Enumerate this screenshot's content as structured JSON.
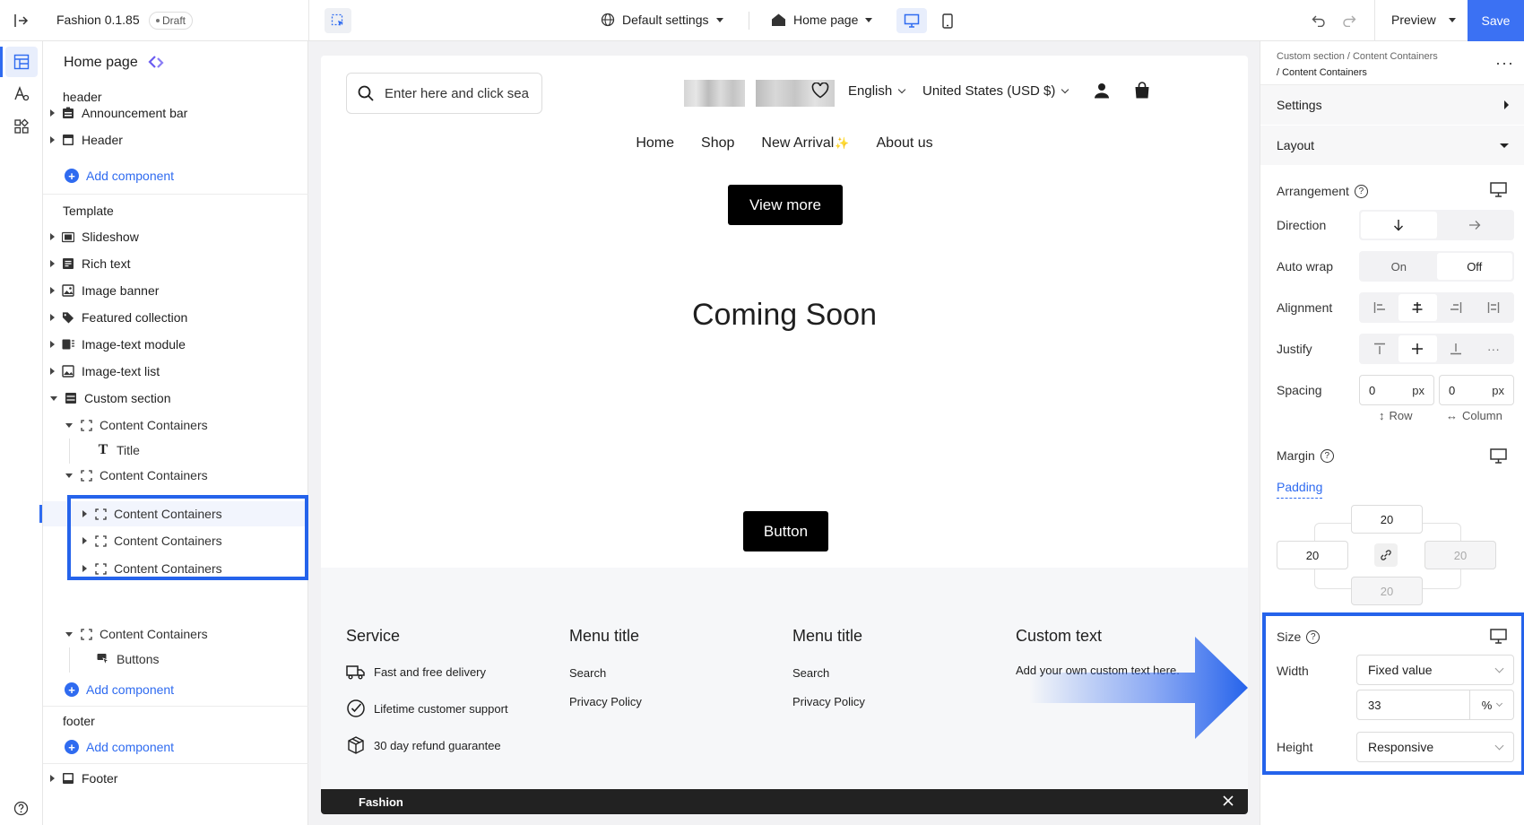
{
  "app": {
    "name": "Fashion 0.1.85",
    "status": "Draft"
  },
  "topbar": {
    "default_settings": "Default settings",
    "page_select": "Home page",
    "preview": "Preview",
    "save": "Save"
  },
  "tree": {
    "page_title": "Home page",
    "header_label": "header",
    "header_items": [
      "Announcement bar",
      "Header"
    ],
    "add_component": "Add component",
    "template_label": "Template",
    "template_items": [
      "Slideshow",
      "Rich text",
      "Image banner",
      "Featured collection",
      "Image-text module",
      "Image-text list",
      "Custom section"
    ],
    "custom": {
      "c1": "Content Containers",
      "c1_child": "Title",
      "c2": "Content Containers",
      "c2_children": [
        "Content Containers",
        "Content Containers",
        "Content Containers"
      ],
      "c3": "Content Containers",
      "c3_child": "Buttons"
    },
    "footer_label": "footer",
    "footer_items": [
      "Footer"
    ]
  },
  "store": {
    "search_placeholder": "Enter here and click sea",
    "language": "English",
    "currency": "United States (USD $)",
    "nav": [
      "Home",
      "Shop",
      "New Arrival",
      "About us"
    ],
    "view_more": "View more",
    "heading": "Coming Soon",
    "button": "Button",
    "footer_cols": [
      {
        "title": "Service",
        "items": [
          "Fast and free delivery",
          "Lifetime customer support",
          "30 day refund guarantee"
        ]
      },
      {
        "title": "Menu title",
        "items": [
          "Search",
          "Privacy Policy"
        ]
      },
      {
        "title": "Menu title",
        "items": [
          "Search",
          "Privacy Policy"
        ]
      },
      {
        "title": "Custom text",
        "items": [
          "Add your own custom text here."
        ]
      }
    ],
    "bottom_bar": "Fashion"
  },
  "props": {
    "breadcrumb_1": "Custom section / Content Containers",
    "breadcrumb_2": "/ Content Containers",
    "settings": "Settings",
    "layout": "Layout",
    "arrangement": "Arrangement",
    "direction": "Direction",
    "auto_wrap": "Auto wrap",
    "on": "On",
    "off": "Off",
    "alignment": "Alignment",
    "justify": "Justify",
    "spacing": "Spacing",
    "spacing_row": "0",
    "spacing_col": "0",
    "unit_px": "px",
    "row": "Row",
    "column": "Column",
    "margin": "Margin",
    "padding": "Padding",
    "pad_top": "20",
    "pad_left": "20",
    "pad_right": "20",
    "pad_bottom": "20",
    "size": "Size",
    "width": "Width",
    "width_mode": "Fixed value",
    "width_value": "33",
    "width_unit": "%",
    "height": "Height",
    "height_mode": "Responsive"
  },
  "colors": {
    "accent": "#2f6bf0",
    "highlight": "#2563eb",
    "dark": "#1f1f1f"
  }
}
